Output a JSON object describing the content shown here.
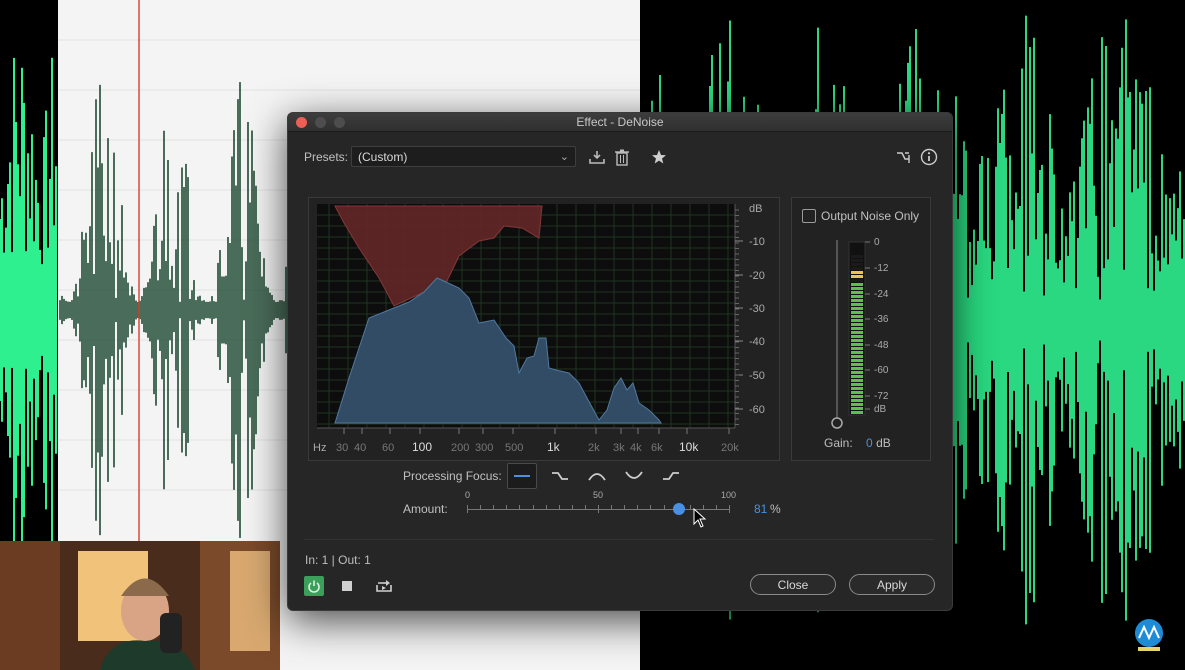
{
  "window": {
    "title": "Effect - DeNoise"
  },
  "presets": {
    "label": "Presets:",
    "value": "(Custom)"
  },
  "icons": {
    "save_preset": "save-preset-icon",
    "delete_preset": "trash-icon",
    "favorite": "star-icon",
    "routing": "routing-icon",
    "info": "info-icon"
  },
  "graph": {
    "db_label": "dB",
    "db_ticks": [
      "-10",
      "-20",
      "-30",
      "-40",
      "-50",
      "-60"
    ],
    "hz_label": "Hz",
    "freq_ticks": [
      "30",
      "40",
      "60",
      "100",
      "200",
      "300",
      "500",
      "1k",
      "2k",
      "3k",
      "4k",
      "6k",
      "10k",
      "20k"
    ],
    "noise_color": "#6e2a2a",
    "signal_color": "#3a5570"
  },
  "output_noise": {
    "label": "Output Noise Only",
    "checked": false
  },
  "meter": {
    "scale": [
      "0",
      "-12",
      "-24",
      "-36",
      "-48",
      "-60",
      "-72",
      "dB"
    ],
    "gain_label": "Gain:",
    "gain_value": "0",
    "gain_unit": "dB"
  },
  "focus": {
    "label": "Processing Focus:",
    "options": [
      "focus-all-icon",
      "focus-low-icon",
      "focus-mid-icon",
      "focus-low-high-icon",
      "focus-high-icon"
    ]
  },
  "amount": {
    "label": "Amount:",
    "min_label": "0",
    "mid_label": "50",
    "max_label": "100",
    "value": "81",
    "fraction": 0.81,
    "unit": "%"
  },
  "status": {
    "in_out": "In: 1 | Out: 1"
  },
  "buttons": {
    "close": "Close",
    "apply": "Apply"
  },
  "colors": {
    "accent": "#4a90e2",
    "wave_green": "#2ef08e",
    "power_green": "#3aa05a"
  }
}
